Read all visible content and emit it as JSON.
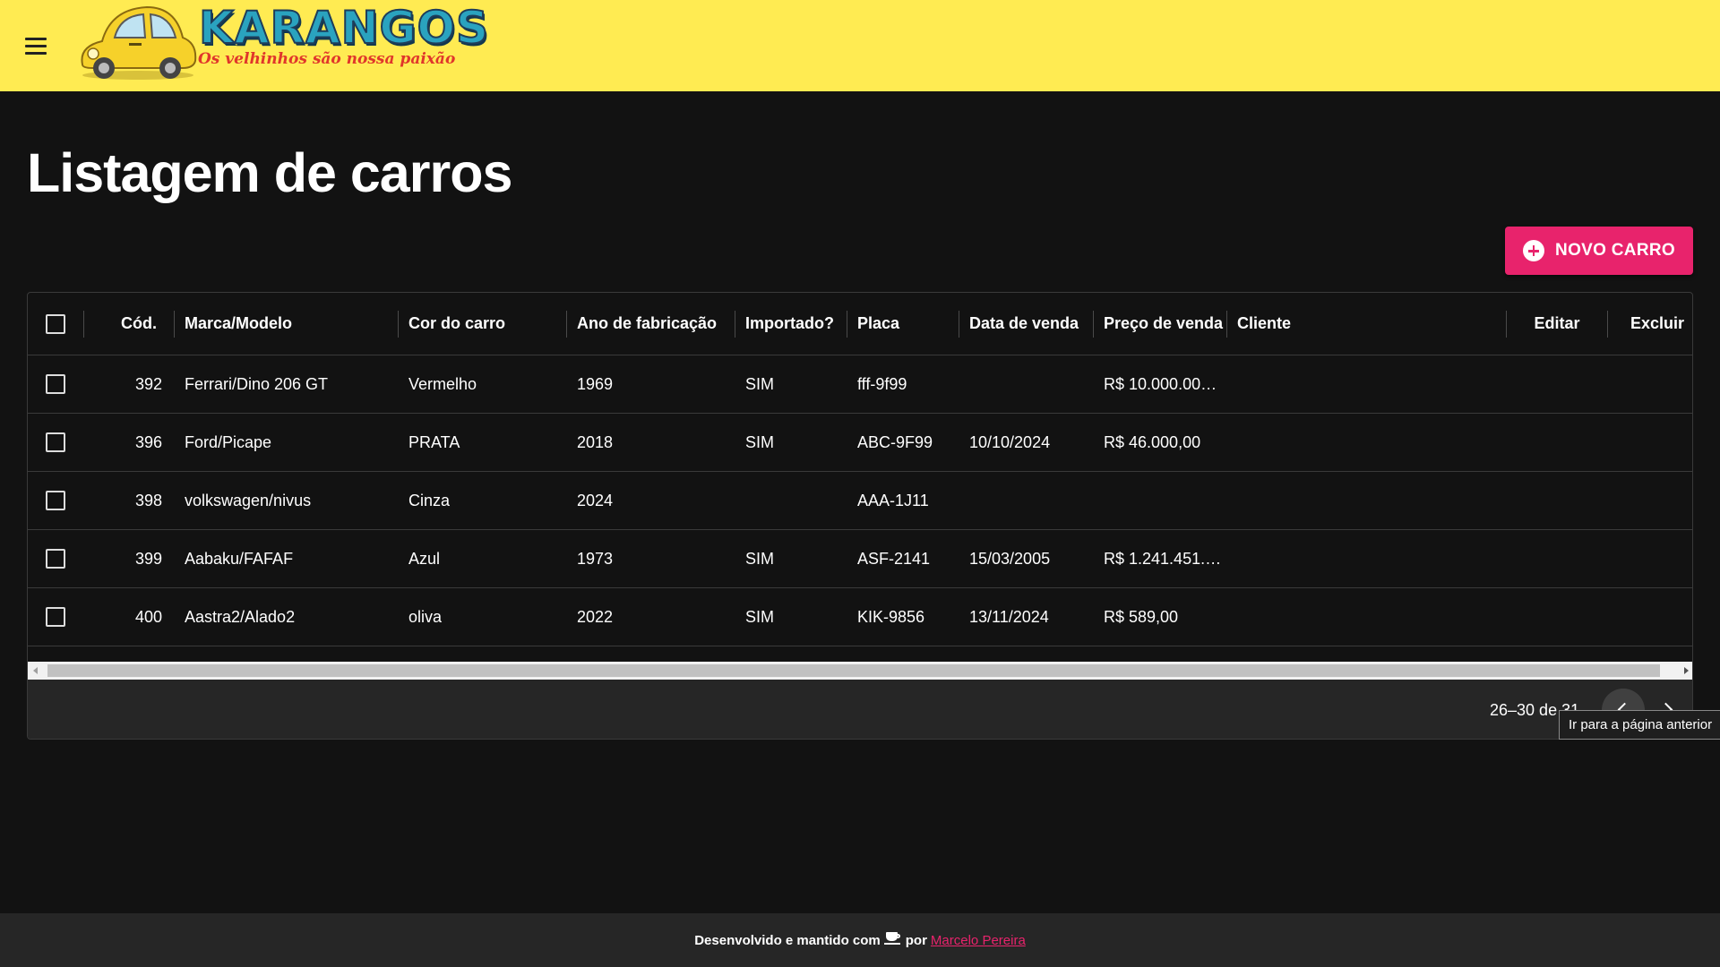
{
  "appbar": {
    "logo_title": "KARANGOS",
    "logo_subtitle": "Os velhinhos são nossa paixão"
  },
  "page_title": "Listagem de carros",
  "new_button_label": "NOVO CARRO",
  "grid": {
    "columns": [
      "Cód.",
      "Marca/Modelo",
      "Cor do carro",
      "Ano de fabricação",
      "Importado?",
      "Placa",
      "Data de venda",
      "Preço de venda",
      "Cliente",
      "Editar",
      "Excluir"
    ],
    "rows": [
      {
        "id": "392",
        "model": "Ferrari/Dino 206 GT",
        "color": "Vermelho",
        "year": "1969",
        "imported": "SIM",
        "plate": "fff-9f99",
        "sale_date": "",
        "price": "R$ 10.000.00…",
        "client": ""
      },
      {
        "id": "396",
        "model": "Ford/Picape",
        "color": "PRATA",
        "year": "2018",
        "imported": "SIM",
        "plate": "ABC-9F99",
        "sale_date": "10/10/2024",
        "price": "R$ 46.000,00",
        "client": ""
      },
      {
        "id": "398",
        "model": "volkswagen/nivus",
        "color": "Cinza",
        "year": "2024",
        "imported": "",
        "plate": "AAA-1J11",
        "sale_date": "",
        "price": "",
        "client": ""
      },
      {
        "id": "399",
        "model": "Aabaku/FAFAF",
        "color": "Azul",
        "year": "1973",
        "imported": "SIM",
        "plate": "ASF-2141",
        "sale_date": "15/03/2005",
        "price": "R$ 1.241.451.…",
        "client": ""
      },
      {
        "id": "400",
        "model": "Aastra2/Alado2",
        "color": "oliva",
        "year": "2022",
        "imported": "SIM",
        "plate": "KIK-9856",
        "sale_date": "13/11/2024",
        "price": "R$ 589,00",
        "client": ""
      }
    ],
    "pagination_text": "26–30 de 31",
    "tooltip": "Ir para a página anterior"
  },
  "footer": {
    "text_before": "Desenvolvido e mantido com",
    "text_por": "por",
    "author": "Marcelo Pereira"
  },
  "colors": {
    "appbar": "#ffeb52",
    "background": "#121212",
    "accent": "#e8236c",
    "footer": "#262626"
  },
  "icons": [
    "menu-icon",
    "car-logo",
    "add-circle-icon",
    "chevron-left-icon",
    "chevron-right-icon",
    "coffee-icon"
  ]
}
